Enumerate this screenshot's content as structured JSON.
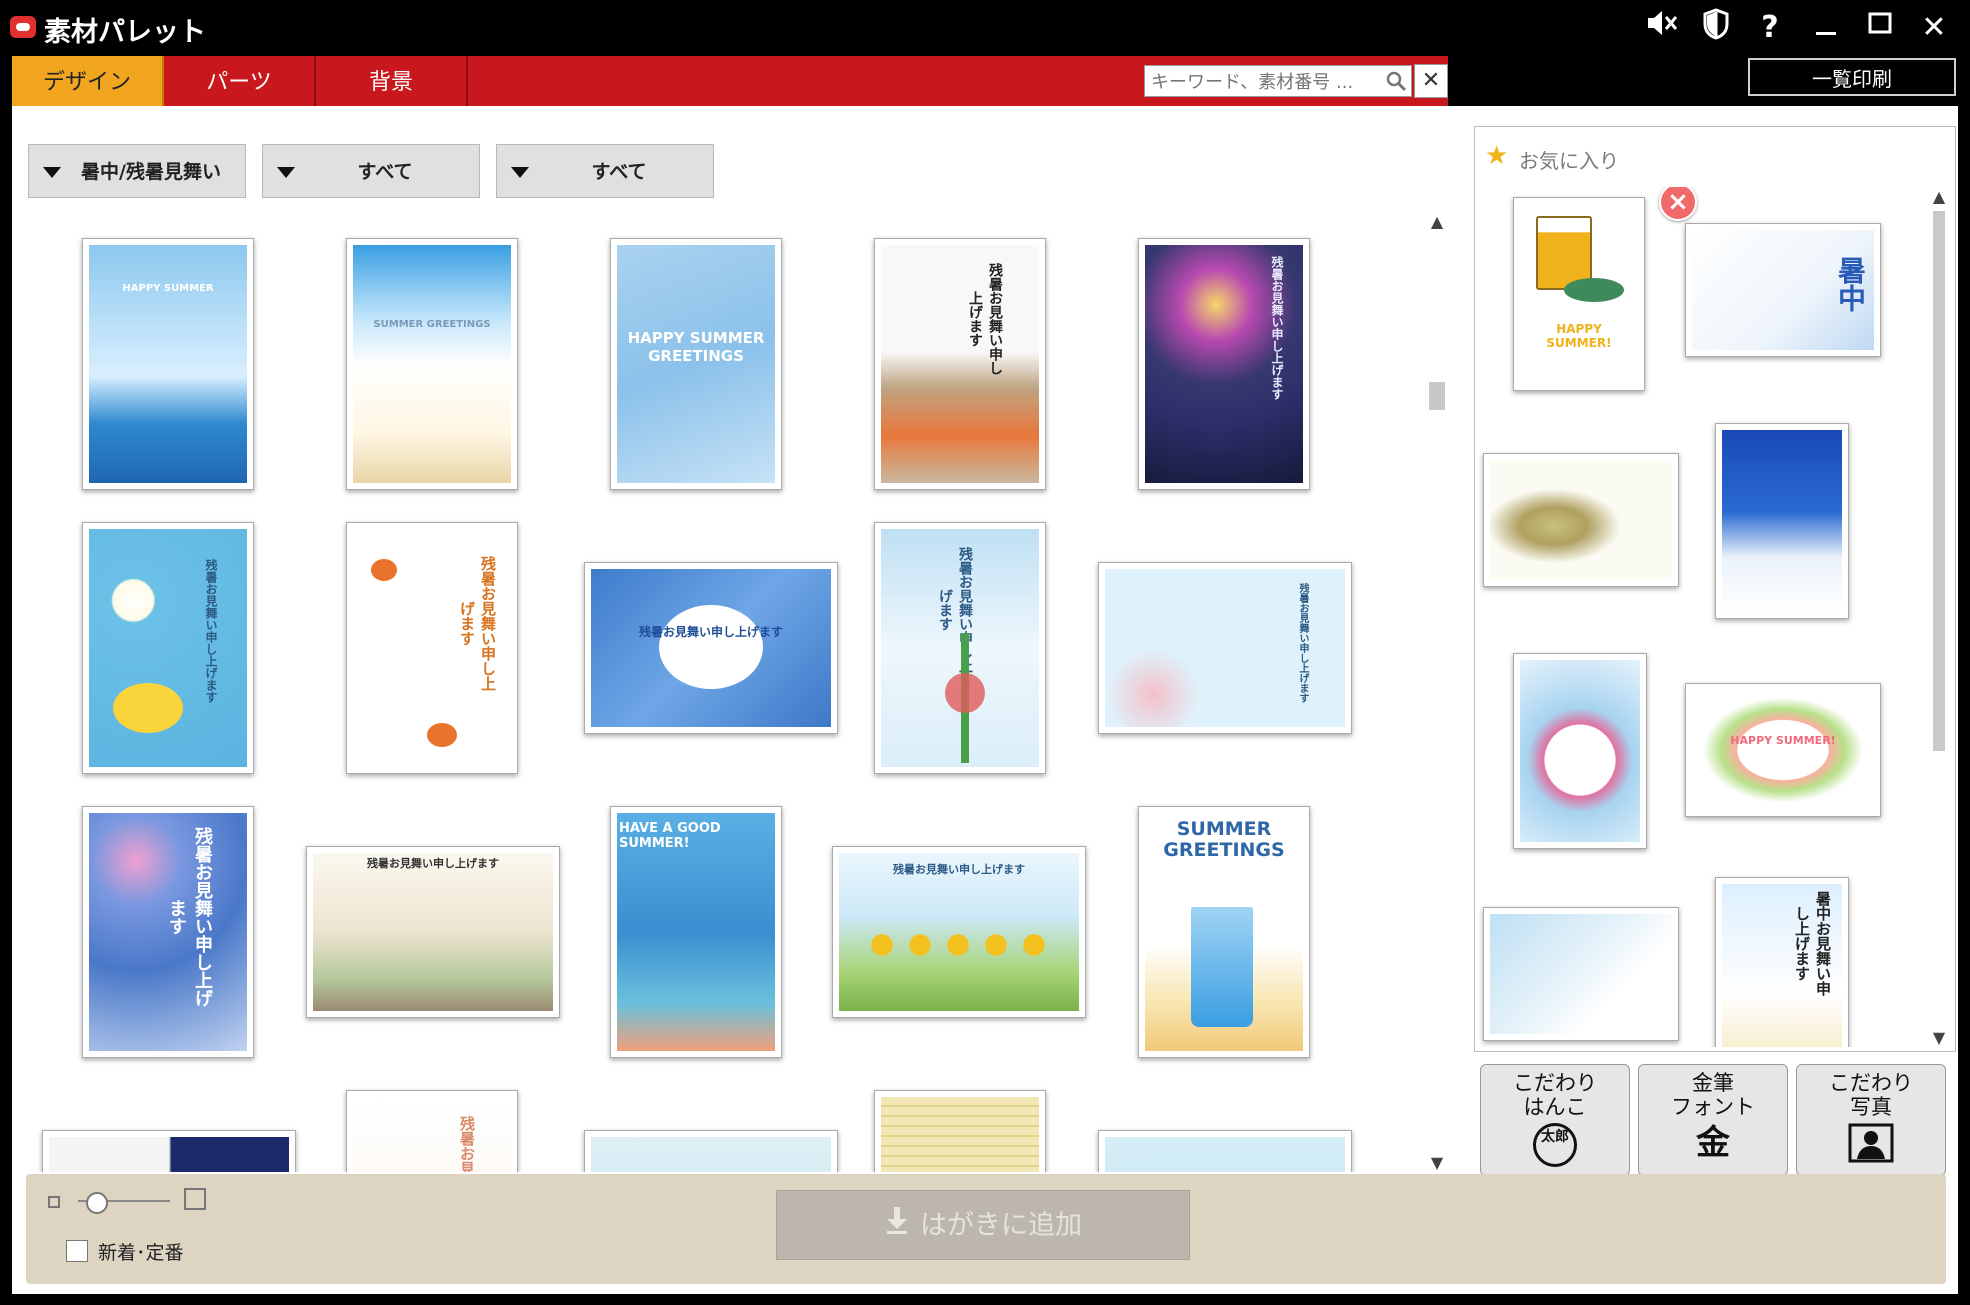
{
  "window": {
    "title": "素材パレット",
    "controls": [
      "mute-icon",
      "shield-icon",
      "help-icon",
      "minimize-icon",
      "maximize-icon",
      "close-icon"
    ],
    "help_glyph": "?",
    "close_glyph": "✕"
  },
  "tabs": [
    {
      "label": "デザイン",
      "active": true
    },
    {
      "label": "パーツ",
      "active": false
    },
    {
      "label": "背景",
      "active": false
    }
  ],
  "search": {
    "placeholder": "キーワード、素材番号 ...",
    "clear_glyph": "✕"
  },
  "print_button": "一覧印刷",
  "filters": [
    {
      "label": "暑中/残暑見舞い"
    },
    {
      "label": "すべて"
    },
    {
      "label": "すべて"
    }
  ],
  "cards": [
    {
      "caption": "HAPPY SUMMER",
      "bg": "#5aaee0",
      "accent": "#ffffff"
    },
    {
      "caption": "SUMMER GREETINGS",
      "bg": "#4aa6e6",
      "accent": "#f4e6c8"
    },
    {
      "caption": "HAPPY SUMMER GREETINGS",
      "bg": "#9bc8ec",
      "accent": "#ffffff"
    },
    {
      "caption": "残暑お見舞い申し上げます",
      "bg": "#f4f4f4",
      "accent": "#e86a2a"
    },
    {
      "caption": "残暑お見舞い申し上げます",
      "bg": "#2c2f6a",
      "accent": "#ffe36a"
    },
    {
      "caption": "残暑お見舞い申し上げます",
      "bg": "#6bc0e6",
      "accent": "#f9d43a"
    },
    {
      "caption": "残暑お見舞い申し上げます",
      "bg": "#ffffff",
      "accent": "#e8732a"
    },
    {
      "caption": "残暑お見舞い申し上げます",
      "bg": "#4e88d6",
      "accent": "#ffffff"
    },
    {
      "caption": "残暑お見舞い申し上げます",
      "bg": "#bfe0f4",
      "accent": "#e05a5a"
    },
    {
      "caption": "残暑お見舞い申し上げます",
      "bg": "#dff1fb",
      "accent": "#f0a6b0"
    },
    {
      "caption": "残暑お見舞い申し上げます",
      "bg": "#4a78c8",
      "accent": "#ffffff"
    },
    {
      "caption": "残暑お見舞い申し上げます",
      "bg": "#e9e2cf",
      "accent": "#8aa86a"
    },
    {
      "caption": "HAVE A GOOD SUMMER!",
      "bg": "#4aa0d8",
      "accent": "#ffffff"
    },
    {
      "caption": "残暑お見舞い申し上げます",
      "bg": "#cde9f8",
      "accent": "#f3c21f"
    },
    {
      "caption": "SUMMER GREETINGS",
      "bg": "#ffffff",
      "accent": "#2e67a8"
    },
    {
      "caption": "",
      "bg": "#1c2a6a",
      "accent": "#ffffff"
    },
    {
      "caption": "残暑お見舞い",
      "bg": "#faf0e4",
      "accent": "#d88a6a"
    },
    {
      "caption": "",
      "bg": "#dff0f6",
      "accent": "#78b48a"
    },
    {
      "caption": "",
      "bg": "#f2e7b4",
      "accent": "#6a9a3a"
    },
    {
      "caption": "",
      "bg": "#d6eef6",
      "accent": "#e04a3a"
    }
  ],
  "favorites": {
    "title": "お気に入り",
    "remove_glyph": "×",
    "items": [
      {
        "caption": "HAPPY SUMMER!",
        "bg": "#ffffff",
        "accent": "#f0b21a"
      },
      {
        "caption": "暑中",
        "bg": "#eef5fb",
        "accent": "#2a5ab8"
      },
      {
        "caption": "",
        "bg": "#fbfbf4",
        "accent": "#b0a060"
      },
      {
        "caption": "",
        "bg": "#2a6ad0",
        "accent": "#ffffff"
      },
      {
        "caption": "",
        "bg": "#e6f3fb",
        "accent": "#e070a0"
      },
      {
        "caption": "HAPPY SUMMER!",
        "bg": "#ffffff",
        "accent": "#f06a7a"
      },
      {
        "caption": "",
        "bg": "#e0f0f8",
        "accent": "#3a6aa8"
      },
      {
        "caption": "暑中お見舞い申し上げます",
        "bg": "#dcefff",
        "accent": "#222222"
      }
    ]
  },
  "feature_buttons": [
    {
      "line1": "こだわり",
      "line2": "はんこ",
      "glyph": "太郎"
    },
    {
      "line1": "金筆",
      "line2": "フォント",
      "glyph": "金"
    },
    {
      "line1": "こだわり",
      "line2": "写真",
      "glyph": "photo"
    }
  ],
  "bottom": {
    "checkbox_label": "新着･定番",
    "checked": false,
    "zoom_level": 0.2,
    "add_button": "はがきに追加"
  },
  "colors": {
    "accent_red": "#c8171d",
    "active_tab": "#f2a51e",
    "bottom_bar": "#ddd4c2"
  }
}
